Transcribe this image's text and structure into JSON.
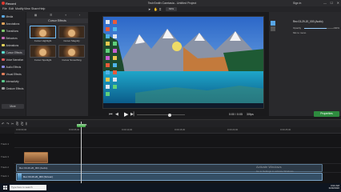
{
  "window": {
    "record_label": "Record",
    "title": "TechSmith Camtasia - Untitled Project",
    "controls": [
      "—",
      "☐",
      "✕"
    ],
    "sign_in": "Sign in"
  },
  "menu": [
    "File",
    "Edit",
    "Modify",
    "View",
    "Share",
    "Help"
  ],
  "sidebar": {
    "items": [
      {
        "label": "Media",
        "color": "#5aa7e0"
      },
      {
        "label": "Annotations",
        "color": "#e0a25a"
      },
      {
        "label": "Transitions",
        "color": "#7fc86b"
      },
      {
        "label": "Behaviors",
        "color": "#c86bb8"
      },
      {
        "label": "Animations",
        "color": "#e0d05a"
      },
      {
        "label": "Cursor Effects",
        "color": "#5ae0d0"
      },
      {
        "label": "Voice Narration",
        "color": "#e05a5a"
      },
      {
        "label": "Audio Effects",
        "color": "#8a8ae0"
      },
      {
        "label": "Visual Effects",
        "color": "#e07e5a"
      },
      {
        "label": "Interactivity",
        "color": "#5ac88a"
      },
      {
        "label": "Gesture Effects",
        "color": "#a0a0a0"
      }
    ],
    "more_label": "More"
  },
  "effects_panel": {
    "header": "Cursor Effects",
    "cards": [
      {
        "label": "Cursor Highlight"
      },
      {
        "label": "Cursor Magnify"
      },
      {
        "label": "Cursor Spotlight"
      },
      {
        "label": "Cursor Smoothing"
      }
    ]
  },
  "canvas": {
    "zoom": "63%"
  },
  "playback": {
    "time": "0:00 / 0:05",
    "fps": "30fps"
  },
  "properties": {
    "clip_title": "Rec 03-29-20_003 (Audio)",
    "opacity_label": "Opacity",
    "opacity_value": "100%",
    "mode_label": "Mix to mono",
    "button_label": "Properties"
  },
  "timeline": {
    "ruler": [
      "0:00:00;00",
      "0:00:05;00",
      "0:00:10;00",
      "0:00:15;00",
      "0:00:20;00",
      "0:00:25;00"
    ],
    "playhead_time": "0:00:00;05",
    "tracks": [
      "Track 4",
      "Track 3",
      "Track 2",
      "Track 1"
    ],
    "audio_clip": "Rec 03-29-20_003 (Audio)",
    "video_clip": "Rec 03-29-20_003 (Screen)"
  },
  "watermark": {
    "line1": "Activate Windows",
    "line2": "Go to Settings to activate Windows."
  },
  "taskbar": {
    "search_placeholder": "Type here to search",
    "time": "3:02 AM",
    "date": "3/29/2020"
  }
}
